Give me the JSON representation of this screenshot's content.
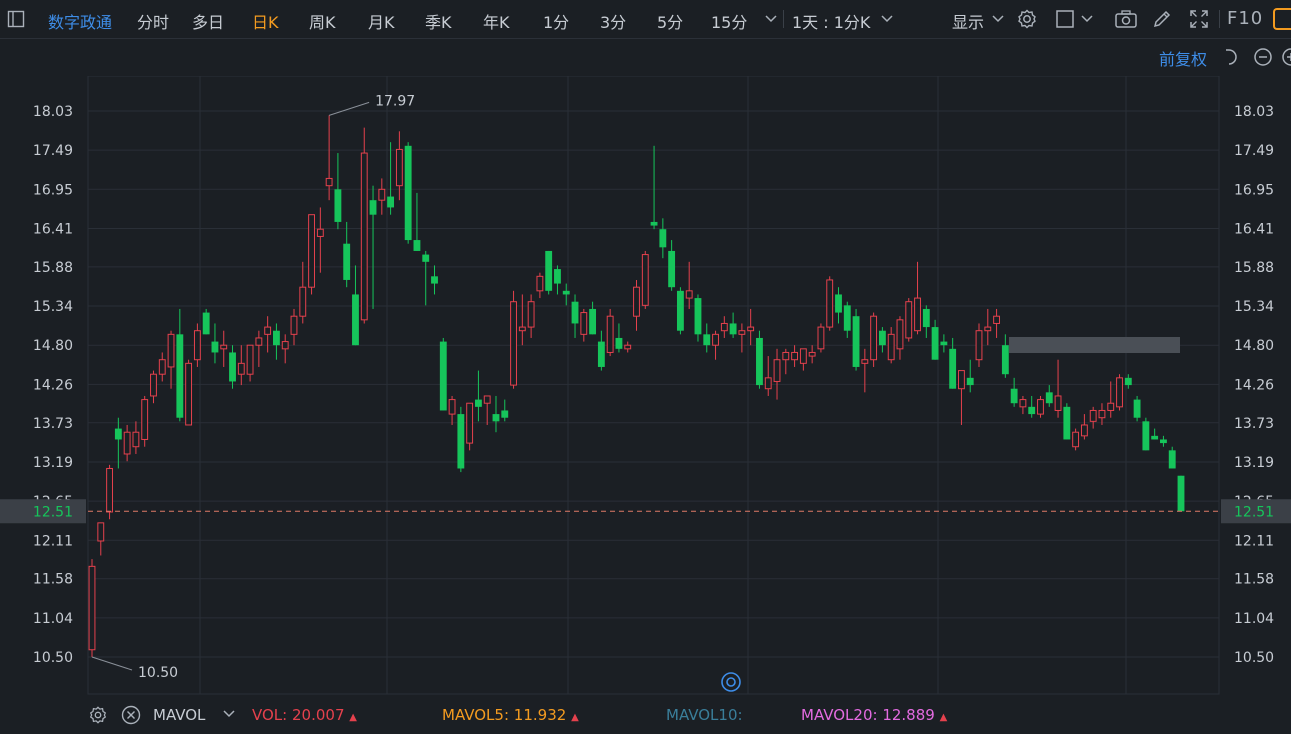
{
  "toolbar": {
    "stock_name": "数字政通",
    "periods": [
      "分时",
      "多日",
      "日K",
      "周K",
      "月K",
      "季K",
      "年K",
      "1分",
      "3分",
      "5分",
      "15分"
    ],
    "active_period": "日K",
    "interval_select": "1天 : 1分K",
    "display_label": "显示",
    "f10_label": "F10"
  },
  "subbar": {
    "adjust_label": "前复权"
  },
  "colors": {
    "up": "#e5414d",
    "down": "#16c55b",
    "active": "#f39b20",
    "link": "#3e8de8",
    "grid": "#2a2f37",
    "axis_text": "#c7ccd3",
    "price_line": "#e07a67",
    "mavol5": "#f39b20",
    "mavol10": "#3a7e9a",
    "mavol20": "#e36be0"
  },
  "chart_data": {
    "type": "candlestick",
    "y_ticks": [
      "18.03",
      "17.49",
      "16.95",
      "16.41",
      "15.88",
      "15.34",
      "14.80",
      "14.26",
      "13.73",
      "13.19",
      "12.65",
      "12.11",
      "11.58",
      "11.04",
      "10.50"
    ],
    "ylim": [
      10.5,
      18.03
    ],
    "high_marker": "17.97",
    "low_marker": "10.50",
    "last_price": "12.51",
    "candles": [
      {
        "o": 10.6,
        "h": 11.85,
        "l": 10.5,
        "c": 11.75
      },
      {
        "o": 12.1,
        "h": 12.35,
        "l": 11.9,
        "c": 12.35
      },
      {
        "o": 12.5,
        "h": 13.15,
        "l": 12.4,
        "c": 13.1
      },
      {
        "o": 13.65,
        "h": 13.8,
        "l": 13.1,
        "c": 13.5
      },
      {
        "o": 13.3,
        "h": 13.7,
        "l": 13.2,
        "c": 13.6
      },
      {
        "o": 13.4,
        "h": 13.75,
        "l": 13.3,
        "c": 13.6
      },
      {
        "o": 13.5,
        "h": 14.1,
        "l": 13.4,
        "c": 14.05
      },
      {
        "o": 14.1,
        "h": 14.45,
        "l": 14.0,
        "c": 14.4
      },
      {
        "o": 14.4,
        "h": 14.7,
        "l": 14.3,
        "c": 14.6
      },
      {
        "o": 14.5,
        "h": 15.0,
        "l": 14.2,
        "c": 14.95
      },
      {
        "o": 14.95,
        "h": 15.3,
        "l": 13.75,
        "c": 13.8
      },
      {
        "o": 13.7,
        "h": 14.6,
        "l": 13.7,
        "c": 14.55
      },
      {
        "o": 14.6,
        "h": 15.1,
        "l": 14.5,
        "c": 15.0
      },
      {
        "o": 15.25,
        "h": 15.3,
        "l": 14.95,
        "c": 14.95
      },
      {
        "o": 14.85,
        "h": 15.1,
        "l": 14.55,
        "c": 14.7
      },
      {
        "o": 14.75,
        "h": 15.0,
        "l": 14.5,
        "c": 14.8
      },
      {
        "o": 14.7,
        "h": 14.8,
        "l": 14.2,
        "c": 14.3
      },
      {
        "o": 14.4,
        "h": 14.8,
        "l": 14.25,
        "c": 14.55
      },
      {
        "o": 14.4,
        "h": 14.8,
        "l": 14.3,
        "c": 14.8
      },
      {
        "o": 14.8,
        "h": 15.0,
        "l": 14.5,
        "c": 14.9
      },
      {
        "o": 14.95,
        "h": 15.2,
        "l": 14.7,
        "c": 15.05
      },
      {
        "o": 15.0,
        "h": 15.1,
        "l": 14.6,
        "c": 14.8
      },
      {
        "o": 14.75,
        "h": 14.95,
        "l": 14.55,
        "c": 14.85
      },
      {
        "o": 14.95,
        "h": 15.3,
        "l": 14.8,
        "c": 15.2
      },
      {
        "o": 15.2,
        "h": 15.95,
        "l": 15.1,
        "c": 15.6
      },
      {
        "o": 15.6,
        "h": 16.6,
        "l": 15.5,
        "c": 16.6
      },
      {
        "o": 16.3,
        "h": 16.7,
        "l": 15.8,
        "c": 16.4
      },
      {
        "o": 17.0,
        "h": 17.97,
        "l": 16.8,
        "c": 17.1
      },
      {
        "o": 16.95,
        "h": 17.45,
        "l": 16.4,
        "c": 16.5
      },
      {
        "o": 16.2,
        "h": 16.5,
        "l": 15.6,
        "c": 15.7
      },
      {
        "o": 15.5,
        "h": 15.9,
        "l": 14.8,
        "c": 14.8
      },
      {
        "o": 15.15,
        "h": 17.8,
        "l": 15.1,
        "c": 17.45
      },
      {
        "o": 16.8,
        "h": 17.0,
        "l": 15.3,
        "c": 16.6
      },
      {
        "o": 16.8,
        "h": 17.1,
        "l": 16.6,
        "c": 16.95
      },
      {
        "o": 16.85,
        "h": 17.6,
        "l": 16.6,
        "c": 16.7
      },
      {
        "o": 17.0,
        "h": 17.75,
        "l": 16.8,
        "c": 17.5
      },
      {
        "o": 17.55,
        "h": 17.6,
        "l": 16.2,
        "c": 16.25
      },
      {
        "o": 16.25,
        "h": 16.9,
        "l": 16.1,
        "c": 16.1
      },
      {
        "o": 16.05,
        "h": 16.1,
        "l": 15.35,
        "c": 15.95
      },
      {
        "o": 15.75,
        "h": 15.9,
        "l": 15.5,
        "c": 15.65
      },
      {
        "o": 14.85,
        "h": 14.9,
        "l": 13.9,
        "c": 13.9
      },
      {
        "o": 13.85,
        "h": 14.1,
        "l": 13.7,
        "c": 14.05
      },
      {
        "o": 13.85,
        "h": 13.95,
        "l": 13.05,
        "c": 13.1
      },
      {
        "o": 13.45,
        "h": 14.0,
        "l": 13.35,
        "c": 14.0
      },
      {
        "o": 14.05,
        "h": 14.45,
        "l": 13.75,
        "c": 13.95
      },
      {
        "o": 14.0,
        "h": 14.1,
        "l": 13.7,
        "c": 14.1
      },
      {
        "o": 13.85,
        "h": 14.1,
        "l": 13.6,
        "c": 13.75
      },
      {
        "o": 13.9,
        "h": 14.05,
        "l": 13.75,
        "c": 13.8
      },
      {
        "o": 14.25,
        "h": 15.55,
        "l": 14.2,
        "c": 15.4
      },
      {
        "o": 15.0,
        "h": 15.5,
        "l": 14.8,
        "c": 15.05
      },
      {
        "o": 15.05,
        "h": 15.5,
        "l": 14.9,
        "c": 15.4
      },
      {
        "o": 15.55,
        "h": 15.8,
        "l": 15.45,
        "c": 15.75
      },
      {
        "o": 16.1,
        "h": 16.1,
        "l": 15.5,
        "c": 15.55
      },
      {
        "o": 15.85,
        "h": 15.9,
        "l": 15.5,
        "c": 15.65
      },
      {
        "o": 15.55,
        "h": 15.65,
        "l": 15.35,
        "c": 15.5
      },
      {
        "o": 15.4,
        "h": 15.5,
        "l": 14.9,
        "c": 15.1
      },
      {
        "o": 14.95,
        "h": 15.3,
        "l": 14.85,
        "c": 15.25
      },
      {
        "o": 15.3,
        "h": 15.4,
        "l": 14.95,
        "c": 14.95
      },
      {
        "o": 14.85,
        "h": 15.0,
        "l": 14.45,
        "c": 14.5
      },
      {
        "o": 14.7,
        "h": 15.3,
        "l": 14.65,
        "c": 15.2
      },
      {
        "o": 14.9,
        "h": 15.1,
        "l": 14.7,
        "c": 14.75
      },
      {
        "o": 14.75,
        "h": 14.85,
        "l": 14.7,
        "c": 14.8
      },
      {
        "o": 15.2,
        "h": 15.7,
        "l": 15.0,
        "c": 15.6
      },
      {
        "o": 15.35,
        "h": 16.1,
        "l": 15.3,
        "c": 16.05
      },
      {
        "o": 16.5,
        "h": 17.55,
        "l": 16.4,
        "c": 16.45
      },
      {
        "o": 16.4,
        "h": 16.55,
        "l": 16.0,
        "c": 16.15
      },
      {
        "o": 16.1,
        "h": 16.25,
        "l": 15.55,
        "c": 15.6
      },
      {
        "o": 15.55,
        "h": 15.6,
        "l": 14.95,
        "c": 15.0
      },
      {
        "o": 15.45,
        "h": 15.95,
        "l": 15.3,
        "c": 15.55
      },
      {
        "o": 15.45,
        "h": 15.5,
        "l": 14.85,
        "c": 14.95
      },
      {
        "o": 14.95,
        "h": 15.1,
        "l": 14.7,
        "c": 14.8
      },
      {
        "o": 14.8,
        "h": 15.0,
        "l": 14.6,
        "c": 14.95
      },
      {
        "o": 15.0,
        "h": 15.2,
        "l": 14.9,
        "c": 15.1
      },
      {
        "o": 15.1,
        "h": 15.25,
        "l": 14.9,
        "c": 14.95
      },
      {
        "o": 14.95,
        "h": 15.1,
        "l": 14.7,
        "c": 15.0
      },
      {
        "o": 15.0,
        "h": 15.3,
        "l": 14.8,
        "c": 15.05
      },
      {
        "o": 14.9,
        "h": 15.0,
        "l": 14.2,
        "c": 14.25
      },
      {
        "o": 14.2,
        "h": 14.65,
        "l": 14.1,
        "c": 14.35
      },
      {
        "o": 14.3,
        "h": 14.75,
        "l": 14.05,
        "c": 14.6
      },
      {
        "o": 14.6,
        "h": 14.75,
        "l": 14.4,
        "c": 14.7
      },
      {
        "o": 14.6,
        "h": 14.8,
        "l": 14.5,
        "c": 14.7
      },
      {
        "o": 14.55,
        "h": 14.75,
        "l": 14.45,
        "c": 14.75
      },
      {
        "o": 14.65,
        "h": 14.8,
        "l": 14.55,
        "c": 14.7
      },
      {
        "o": 14.75,
        "h": 15.1,
        "l": 14.7,
        "c": 15.05
      },
      {
        "o": 15.05,
        "h": 15.75,
        "l": 15.0,
        "c": 15.7
      },
      {
        "o": 15.5,
        "h": 15.6,
        "l": 15.1,
        "c": 15.25
      },
      {
        "o": 15.35,
        "h": 15.4,
        "l": 14.9,
        "c": 15.0
      },
      {
        "o": 15.2,
        "h": 15.3,
        "l": 14.45,
        "c": 14.5
      },
      {
        "o": 14.55,
        "h": 14.75,
        "l": 14.15,
        "c": 14.6
      },
      {
        "o": 14.6,
        "h": 15.25,
        "l": 14.5,
        "c": 15.2
      },
      {
        "o": 15.0,
        "h": 15.05,
        "l": 14.7,
        "c": 14.8
      },
      {
        "o": 14.6,
        "h": 15.05,
        "l": 14.55,
        "c": 14.95
      },
      {
        "o": 14.75,
        "h": 15.2,
        "l": 14.6,
        "c": 15.15
      },
      {
        "o": 14.9,
        "h": 15.45,
        "l": 14.85,
        "c": 15.4
      },
      {
        "o": 15.0,
        "h": 15.95,
        "l": 14.95,
        "c": 15.45
      },
      {
        "o": 15.3,
        "h": 15.35,
        "l": 14.9,
        "c": 15.05
      },
      {
        "o": 15.05,
        "h": 15.15,
        "l": 14.6,
        "c": 14.6
      },
      {
        "o": 14.85,
        "h": 14.95,
        "l": 14.7,
        "c": 14.8
      },
      {
        "o": 14.75,
        "h": 14.9,
        "l": 14.2,
        "c": 14.2
      },
      {
        "o": 14.2,
        "h": 14.45,
        "l": 13.7,
        "c": 14.45
      },
      {
        "o": 14.35,
        "h": 14.6,
        "l": 14.15,
        "c": 14.25
      },
      {
        "o": 14.6,
        "h": 15.1,
        "l": 14.5,
        "c": 15.0
      },
      {
        "o": 15.0,
        "h": 15.3,
        "l": 14.8,
        "c": 15.05
      },
      {
        "o": 15.1,
        "h": 15.3,
        "l": 14.9,
        "c": 15.2
      },
      {
        "o": 14.8,
        "h": 14.95,
        "l": 14.35,
        "c": 14.4
      },
      {
        "o": 14.2,
        "h": 14.35,
        "l": 13.95,
        "c": 14.0
      },
      {
        "o": 13.95,
        "h": 14.1,
        "l": 13.85,
        "c": 14.05
      },
      {
        "o": 13.95,
        "h": 14.1,
        "l": 13.8,
        "c": 13.85
      },
      {
        "o": 13.85,
        "h": 14.1,
        "l": 13.8,
        "c": 14.05
      },
      {
        "o": 14.15,
        "h": 14.25,
        "l": 13.95,
        "c": 14.0
      },
      {
        "o": 13.9,
        "h": 14.6,
        "l": 13.8,
        "c": 14.1
      },
      {
        "o": 13.95,
        "h": 14.0,
        "l": 13.5,
        "c": 13.5
      },
      {
        "o": 13.4,
        "h": 13.65,
        "l": 13.35,
        "c": 13.6
      },
      {
        "o": 13.55,
        "h": 13.85,
        "l": 13.5,
        "c": 13.7
      },
      {
        "o": 13.75,
        "h": 13.95,
        "l": 13.65,
        "c": 13.9
      },
      {
        "o": 13.8,
        "h": 14.0,
        "l": 13.7,
        "c": 13.9
      },
      {
        "o": 13.9,
        "h": 14.3,
        "l": 13.8,
        "c": 14.0
      },
      {
        "o": 13.95,
        "h": 14.4,
        "l": 13.9,
        "c": 14.35
      },
      {
        "o": 14.35,
        "h": 14.4,
        "l": 14.2,
        "c": 14.25
      },
      {
        "o": 14.05,
        "h": 14.1,
        "l": 13.75,
        "c": 13.8
      },
      {
        "o": 13.75,
        "h": 13.8,
        "l": 13.35,
        "c": 13.35
      },
      {
        "o": 13.55,
        "h": 13.65,
        "l": 13.5,
        "c": 13.5
      },
      {
        "o": 13.5,
        "h": 13.55,
        "l": 13.4,
        "c": 13.45
      },
      {
        "o": 13.35,
        "h": 13.4,
        "l": 13.1,
        "c": 13.1
      },
      {
        "o": 13.0,
        "h": 13.0,
        "l": 12.51,
        "c": 12.51
      }
    ]
  },
  "mavol": {
    "name": "MAVOL",
    "vol_label": "VOL:",
    "vol_value": "20.007",
    "ma5_label": "MAVOL5:",
    "ma5_value": "11.932",
    "ma10_label": "MAVOL10:",
    "ma20_label": "MAVOL20:",
    "ma20_value": "12.889"
  }
}
